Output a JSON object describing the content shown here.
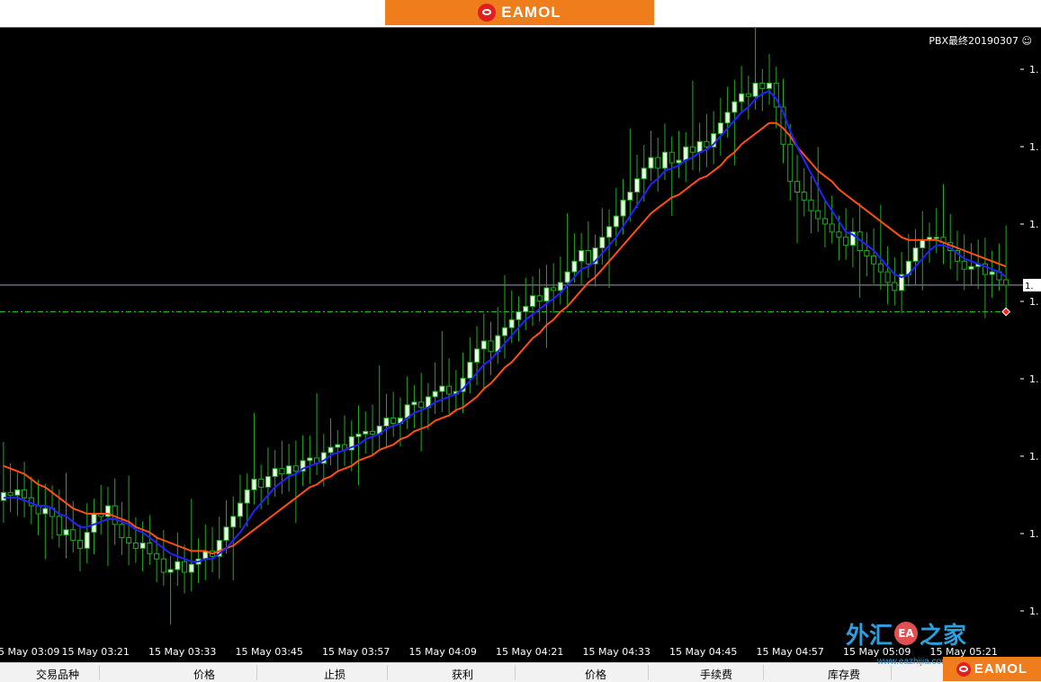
{
  "brand": {
    "name": "EAMOL",
    "color": "#f07d1c",
    "logo_icon": "eamol-logo-icon"
  },
  "chart": {
    "indicator_title": "PBX最终20190307",
    "smiley_glyph": "☺",
    "price_label_partial": "1.",
    "axis_tick_partials": [
      "1.",
      "1.",
      "1.",
      "1.",
      "1.",
      "1.",
      "1.",
      "1."
    ],
    "colors": {
      "background": "#000000",
      "bull": "#e8ffe0",
      "bear": "#22aa22",
      "fast_ma": "#2222ff",
      "slow_ma": "#ff5010",
      "price_line": "#9aa0b0",
      "level_line": "#22bb22"
    }
  },
  "chart_data": {
    "type": "candlestick",
    "x_ticks": [
      "5 May 03:09",
      "15 May 03:21",
      "15 May 03:33",
      "15 May 03:45",
      "15 May 03:57",
      "15 May 04:09",
      "15 May 04:21",
      "15 May 04:33",
      "15 May 04:45",
      "15 May 04:57",
      "15 May 05:09",
      "15 May 05:21"
    ],
    "close": [
      0.52,
      0.51,
      0.53,
      0.5,
      0.47,
      0.44,
      0.46,
      0.43,
      0.36,
      0.38,
      0.34,
      0.31,
      0.37,
      0.44,
      0.43,
      0.47,
      0.4,
      0.35,
      0.33,
      0.31,
      0.33,
      0.29,
      0.27,
      0.22,
      0.23,
      0.26,
      0.22,
      0.25,
      0.27,
      0.3,
      0.28,
      0.34,
      0.39,
      0.43,
      0.48,
      0.53,
      0.57,
      0.54,
      0.58,
      0.61,
      0.59,
      0.62,
      0.6,
      0.64,
      0.65,
      0.63,
      0.67,
      0.69,
      0.7,
      0.68,
      0.73,
      0.74,
      0.75,
      0.74,
      0.77,
      0.8,
      0.78,
      0.8,
      0.85,
      0.86,
      0.84,
      0.88,
      0.9,
      0.92,
      0.89,
      0.9,
      0.95,
      1.01,
      1.06,
      1.09,
      1.05,
      1.11,
      1.14,
      1.17,
      1.2,
      1.22,
      1.26,
      1.24,
      1.29,
      1.28,
      1.31,
      1.35,
      1.39,
      1.43,
      1.38,
      1.44,
      1.48,
      1.52,
      1.56,
      1.62,
      1.65,
      1.7,
      1.74,
      1.78,
      1.74,
      1.8,
      1.76,
      1.77,
      1.82,
      1.8,
      1.84,
      1.82,
      1.87,
      1.91,
      1.95,
      1.99,
      2.02,
      2.01,
      2.06,
      2.04,
      2.06,
      1.97,
      1.83,
      1.69,
      1.65,
      1.62,
      1.58,
      1.55,
      1.53,
      1.5,
      1.48,
      1.45,
      1.5,
      1.43,
      1.41,
      1.38,
      1.35,
      1.31,
      1.28,
      1.34,
      1.39,
      1.44,
      1.47,
      1.48,
      1.48,
      1.46,
      1.43,
      1.39,
      1.36,
      1.37,
      1.38,
      1.34,
      1.35,
      1.32,
      1.3
    ],
    "fast_ma": [
      0.5,
      0.5,
      0.5,
      0.49,
      0.48,
      0.47,
      0.47,
      0.46,
      0.44,
      0.43,
      0.41,
      0.39,
      0.39,
      0.4,
      0.41,
      0.42,
      0.42,
      0.41,
      0.4,
      0.38,
      0.37,
      0.35,
      0.33,
      0.31,
      0.29,
      0.28,
      0.27,
      0.26,
      0.26,
      0.27,
      0.27,
      0.29,
      0.31,
      0.34,
      0.37,
      0.41,
      0.45,
      0.48,
      0.51,
      0.54,
      0.56,
      0.58,
      0.59,
      0.61,
      0.62,
      0.63,
      0.64,
      0.66,
      0.67,
      0.68,
      0.69,
      0.7,
      0.72,
      0.73,
      0.74,
      0.76,
      0.77,
      0.78,
      0.8,
      0.82,
      0.83,
      0.84,
      0.86,
      0.87,
      0.88,
      0.89,
      0.91,
      0.94,
      0.97,
      1.0,
      1.02,
      1.05,
      1.08,
      1.11,
      1.14,
      1.17,
      1.19,
      1.21,
      1.23,
      1.25,
      1.27,
      1.3,
      1.33,
      1.36,
      1.37,
      1.39,
      1.42,
      1.45,
      1.48,
      1.52,
      1.56,
      1.6,
      1.64,
      1.68,
      1.7,
      1.73,
      1.74,
      1.75,
      1.77,
      1.78,
      1.8,
      1.81,
      1.83,
      1.86,
      1.89,
      1.92,
      1.95,
      1.97,
      2.0,
      2.02,
      2.03,
      2.0,
      1.95,
      1.88,
      1.82,
      1.77,
      1.72,
      1.67,
      1.62,
      1.58,
      1.54,
      1.5,
      1.49,
      1.47,
      1.45,
      1.43,
      1.4,
      1.37,
      1.34,
      1.33,
      1.34,
      1.37,
      1.4,
      1.43,
      1.45,
      1.45,
      1.44,
      1.42,
      1.4,
      1.39,
      1.38,
      1.37,
      1.36,
      1.35,
      1.33
    ],
    "slow_ma": [
      0.62,
      0.61,
      0.6,
      0.59,
      0.57,
      0.55,
      0.54,
      0.52,
      0.5,
      0.48,
      0.46,
      0.45,
      0.44,
      0.44,
      0.44,
      0.44,
      0.43,
      0.42,
      0.41,
      0.39,
      0.38,
      0.37,
      0.35,
      0.34,
      0.33,
      0.32,
      0.31,
      0.3,
      0.3,
      0.3,
      0.29,
      0.3,
      0.31,
      0.32,
      0.34,
      0.36,
      0.38,
      0.4,
      0.42,
      0.44,
      0.46,
      0.48,
      0.5,
      0.52,
      0.54,
      0.55,
      0.57,
      0.58,
      0.6,
      0.61,
      0.62,
      0.64,
      0.65,
      0.66,
      0.68,
      0.69,
      0.7,
      0.72,
      0.73,
      0.75,
      0.76,
      0.77,
      0.79,
      0.8,
      0.81,
      0.83,
      0.84,
      0.86,
      0.88,
      0.91,
      0.93,
      0.96,
      0.99,
      1.01,
      1.04,
      1.07,
      1.1,
      1.12,
      1.15,
      1.17,
      1.2,
      1.22,
      1.25,
      1.28,
      1.31,
      1.33,
      1.36,
      1.39,
      1.42,
      1.45,
      1.48,
      1.51,
      1.54,
      1.57,
      1.59,
      1.61,
      1.63,
      1.64,
      1.66,
      1.68,
      1.7,
      1.71,
      1.73,
      1.75,
      1.78,
      1.8,
      1.83,
      1.85,
      1.87,
      1.89,
      1.91,
      1.91,
      1.89,
      1.86,
      1.82,
      1.79,
      1.76,
      1.73,
      1.71,
      1.69,
      1.66,
      1.64,
      1.62,
      1.6,
      1.58,
      1.56,
      1.54,
      1.52,
      1.5,
      1.48,
      1.47,
      1.47,
      1.47,
      1.47,
      1.47,
      1.46,
      1.45,
      1.44,
      1.43,
      1.42,
      1.41,
      1.4,
      1.39,
      1.38,
      1.37
    ],
    "current_price": 1.3,
    "level": 1.2,
    "ylim": [
      0,
      2.2
    ]
  },
  "table": {
    "columns": [
      "交易品种",
      "价格",
      "止损",
      "获利",
      "价格",
      "手续费",
      "库存费"
    ]
  },
  "watermark": {
    "text_left": "外汇",
    "badge": "EA",
    "text_right": "之家",
    "url": "www.eazhijia.com"
  }
}
